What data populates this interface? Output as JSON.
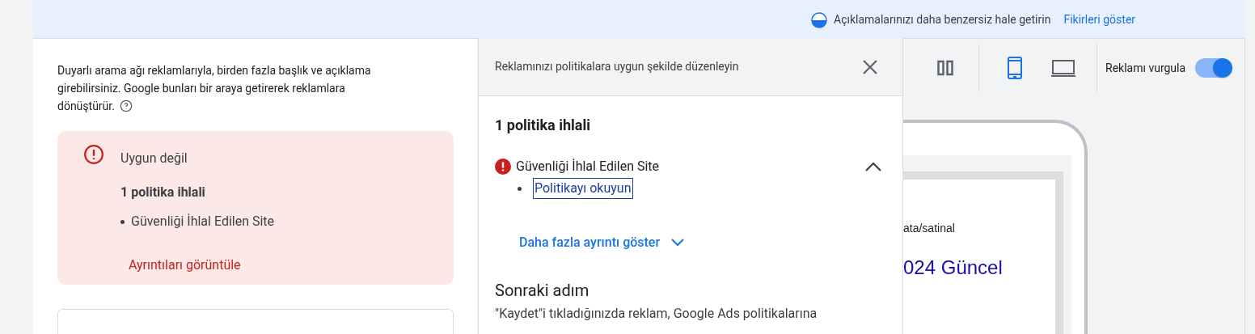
{
  "banner": {
    "tip": "Açıklamalarınızı daha benzersiz hale getirin",
    "tip_link": "Fikirleri göster"
  },
  "intro": {
    "text": "Duyarlı arama ağı reklamlarıyla, birden fazla başlık ve açıklama girebilirsiniz. Google bunları bir araya getirerek reklamlara dönüştürür."
  },
  "status_card": {
    "title": "Uygun değil",
    "count": "1 politika ihlali",
    "violations": [
      "Güvenliği İhlal Edilen Site"
    ],
    "link": "Ayrıntıları görüntüle"
  },
  "panel": {
    "title": "Reklamınızı politikalara uygun şekilde düzenleyin",
    "heading": "1 politika ihlali",
    "issues": [
      {
        "name": "Güvenliği İhlal Edilen Site",
        "expanded": true,
        "links": [
          "Politikayı okuyun"
        ]
      }
    ],
    "more": "Daha fazla ayrıntı göster",
    "next_title": "Sonraki adım",
    "next_text": "\"Kaydet\"i tıkladığınızda reklam, Google Ads politikalarına"
  },
  "toolbar": {
    "devices": [
      {
        "kind": "mobile",
        "selected": true
      },
      {
        "kind": "desktop",
        "selected": false
      }
    ],
    "highlight_label": "Reklamı vurgula",
    "highlight_on": true
  },
  "preview": {
    "url": "ata/satinal",
    "headline": "024 Güncel"
  }
}
